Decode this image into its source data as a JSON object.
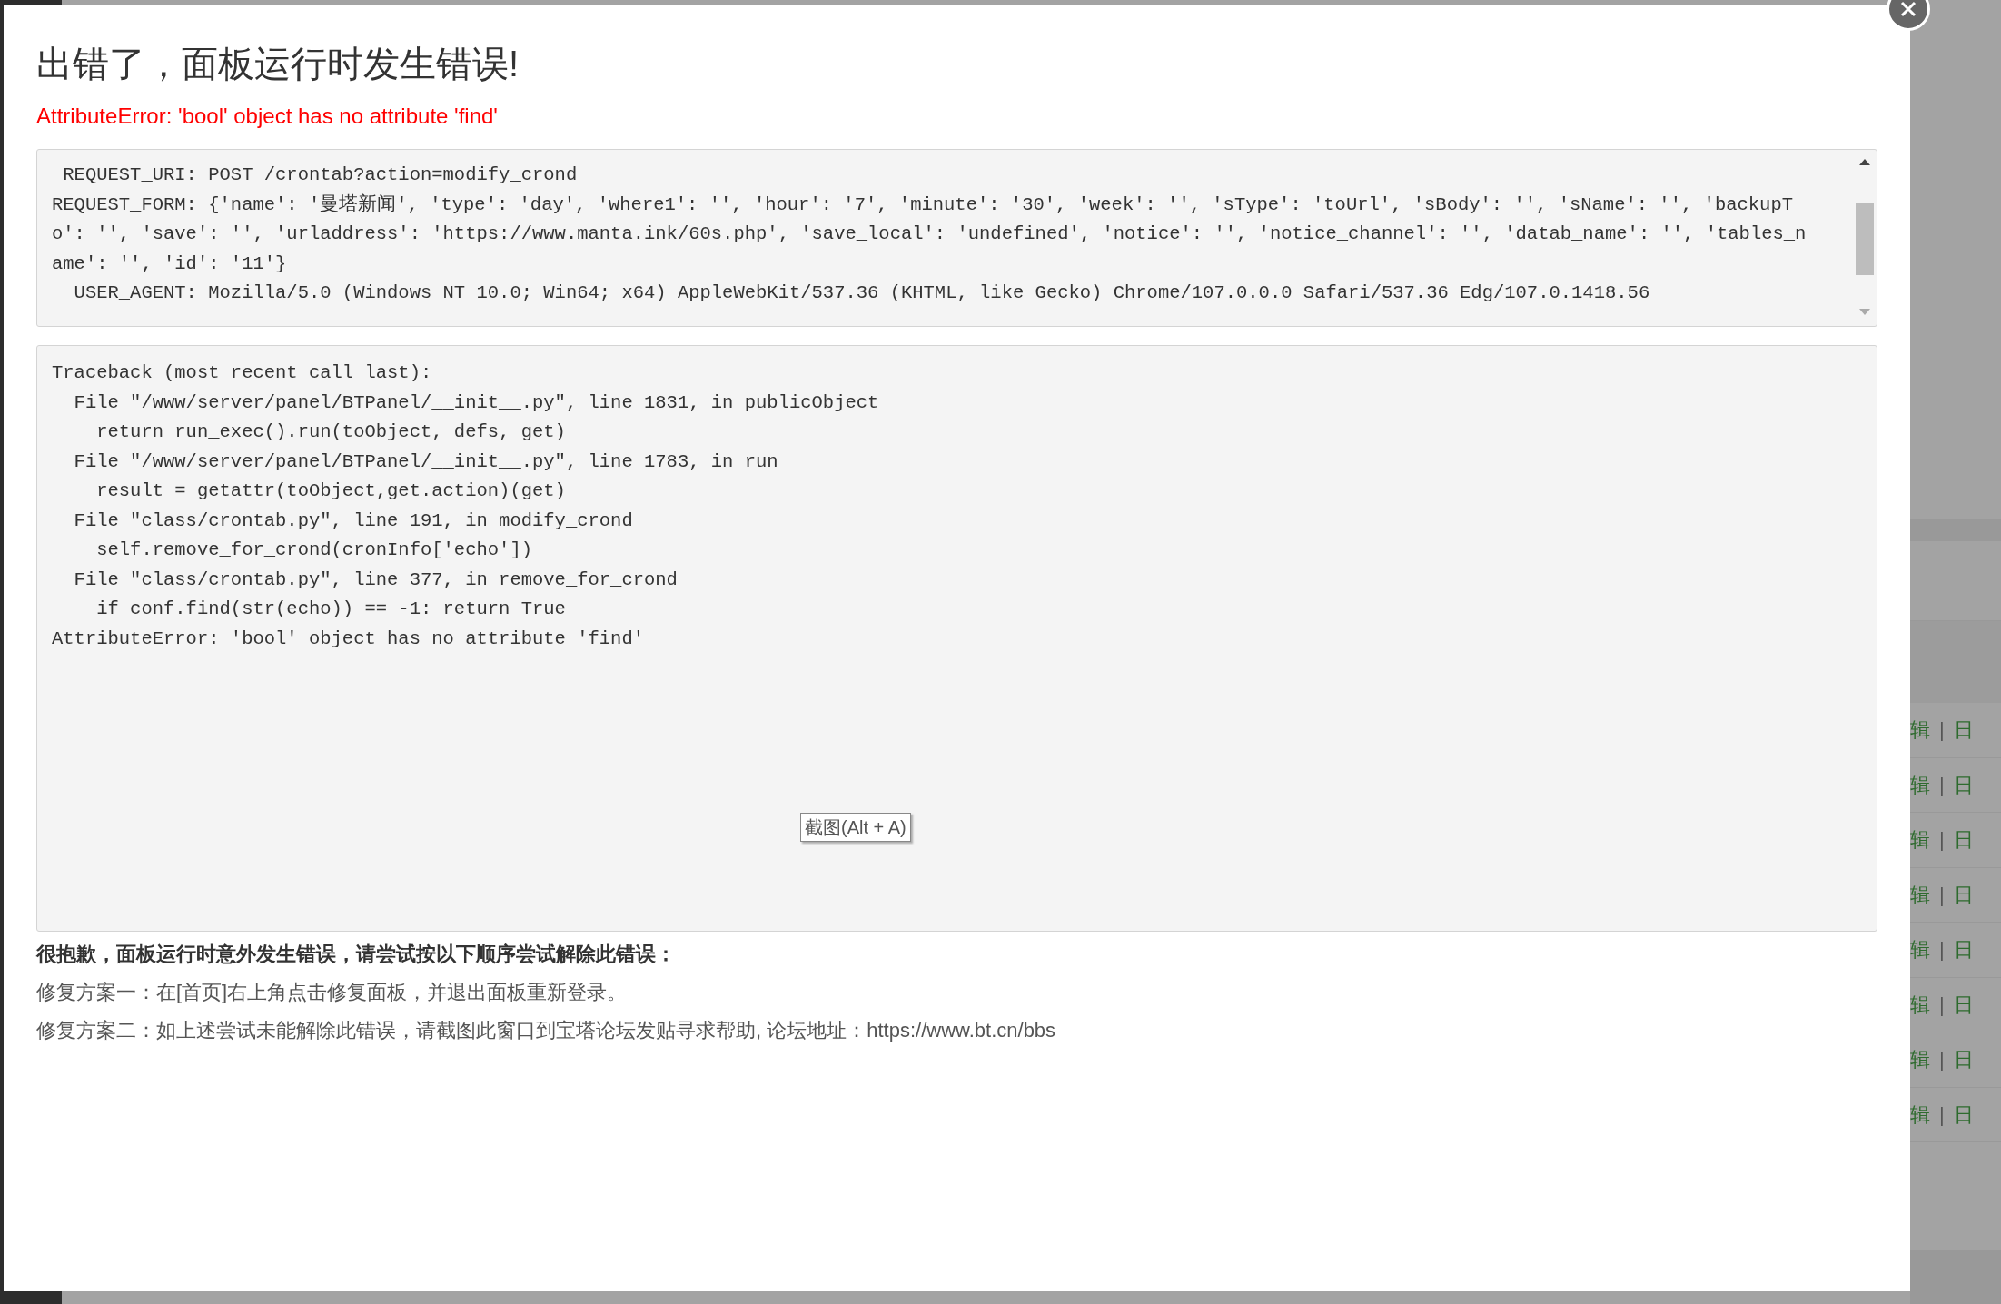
{
  "dialog": {
    "title": "出错了，面板运行时发生错误!",
    "error": "AttributeError: 'bool' object has no attribute 'find'",
    "request_lines": [
      " REQUEST_URI: POST /crontab?action=modify_crond",
      "REQUEST_FORM: {'name': '曼塔新闻', 'type': 'day', 'where1': '', 'hour': '7', 'minute': '30', 'week': '', 'sType': 'toUrl', 'sBody': '', 'sName': '', 'backupT",
      "o': '', 'save': '', 'urladdress': 'https://www.manta.ink/60s.php', 'save_local': 'undefined', 'notice': '', 'notice_channel': '', 'datab_name': '', 'tables_n",
      "ame': '', 'id': '11'}",
      "  USER_AGENT: Mozilla/5.0 (Windows NT 10.0; Win64; x64) AppleWebKit/537.36 (KHTML, like Gecko) Chrome/107.0.0.0 Safari/537.36 Edg/107.0.1418.56"
    ],
    "traceback_lines": [
      "Traceback (most recent call last):",
      "  File \"/www/server/panel/BTPanel/__init__.py\", line 1831, in publicObject",
      "    return run_exec().run(toObject, defs, get)",
      "  File \"/www/server/panel/BTPanel/__init__.py\", line 1783, in run",
      "    result = getattr(toObject,get.action)(get)",
      "  File \"class/crontab.py\", line 191, in modify_crond",
      "    self.remove_for_crond(cronInfo['echo'])",
      "  File \"class/crontab.py\", line 377, in remove_for_crond",
      "    if conf.find(str(echo)) == -1: return True",
      "AttributeError: 'bool' object has no attribute 'find'"
    ],
    "tooltip": "截图(Alt + A)",
    "help_heading": "很抱歉，面板运行时意外发生错误，请尝试按以下顺序尝试解除此错误：",
    "help_lines": [
      "修复方案一：在[首页]右上角点击修复面板，并退出面板重新登录。",
      "修复方案二：如上述尝试未能解除此错误，请截图此窗口到宝塔论坛发贴寻求帮助, 论坛地址：https://www.bt.cn/bbs"
    ]
  },
  "background_rows": [
    {
      "edit": "辑",
      "separator": "|",
      "log": "日"
    },
    {
      "edit": "辑",
      "separator": "|",
      "log": "日"
    },
    {
      "edit": "辑",
      "separator": "|",
      "log": "日"
    },
    {
      "edit": "辑",
      "separator": "|",
      "log": "日"
    },
    {
      "edit": "辑",
      "separator": "|",
      "log": "日"
    },
    {
      "edit": "辑",
      "separator": "|",
      "log": "日"
    },
    {
      "edit": "辑",
      "separator": "|",
      "log": "日"
    },
    {
      "edit": "辑",
      "separator": "|",
      "log": "日"
    }
  ]
}
